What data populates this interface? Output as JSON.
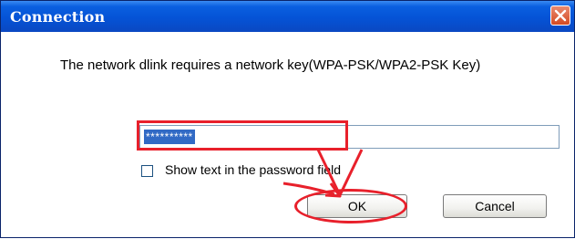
{
  "window": {
    "title": "Connection"
  },
  "message": "The network dlink requires a network key(WPA-PSK/WPA2-PSK Key)",
  "network_key": {
    "value": "**********"
  },
  "show_password": {
    "label": "Show text in the password field",
    "checked": false
  },
  "buttons": {
    "ok_label": "OK",
    "cancel_label": "Cancel"
  },
  "colors": {
    "title_bar": "#0553d6",
    "selection": "#316ac5",
    "annotation": "#e8202b"
  },
  "icons": [
    "close-icon",
    "annotation-arrow"
  ]
}
